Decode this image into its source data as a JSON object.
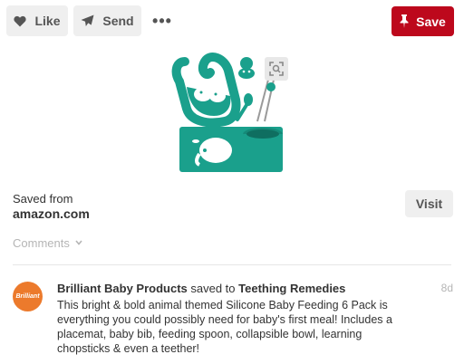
{
  "toolbar": {
    "like_label": "Like",
    "send_label": "Send",
    "more_label": "•••",
    "save_label": "Save"
  },
  "pin": {
    "image_icon": "product-image",
    "lens_icon": "visual-search-icon"
  },
  "source": {
    "saved_from_label": "Saved from",
    "domain": "amazon.com",
    "visit_label": "Visit"
  },
  "comments": {
    "label": "Comments"
  },
  "activity": {
    "avatar_text": "Brilliant",
    "user": "Brilliant Baby Products",
    "action": "saved to",
    "board": "Teething Remedies",
    "time": "8d",
    "description": "This bright & bold animal themed Silicone Baby Feeding 6 Pack is everything you could possibly need for baby's first meal! Includes a placemat, baby bib, feeding spoon, collapsible bowl, learning chopsticks & even a teether!"
  },
  "colors": {
    "save_red": "#bd081c",
    "button_gray": "#efefef",
    "avatar_orange": "#ec7a2c",
    "product_teal": "#1aa08c"
  }
}
